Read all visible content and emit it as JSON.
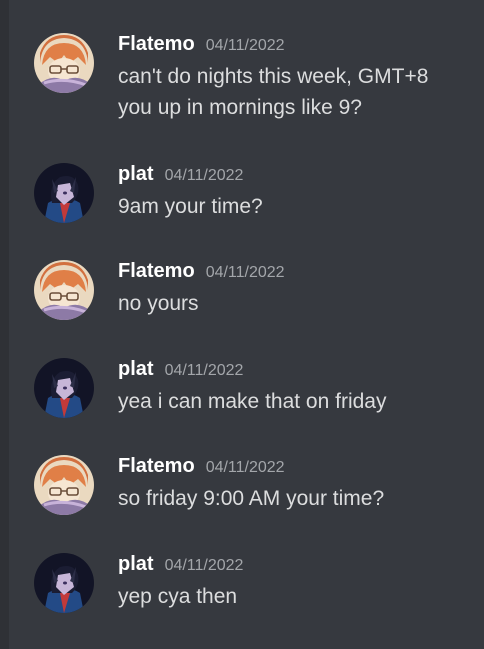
{
  "messages": [
    {
      "author": "Flatemo",
      "avatar": "flatemo-avatar",
      "timestamp": "04/11/2022",
      "lines": [
        "can't do nights this week, GMT+8",
        "you up in mornings like 9?"
      ]
    },
    {
      "author": "plat",
      "avatar": "plat-avatar",
      "timestamp": "04/11/2022",
      "lines": [
        "9am your time?"
      ]
    },
    {
      "author": "Flatemo",
      "avatar": "flatemo-avatar",
      "timestamp": "04/11/2022",
      "lines": [
        "no yours"
      ]
    },
    {
      "author": "plat",
      "avatar": "plat-avatar",
      "timestamp": "04/11/2022",
      "lines": [
        "yea i can make that on friday"
      ]
    },
    {
      "author": "Flatemo",
      "avatar": "flatemo-avatar",
      "timestamp": "04/11/2022",
      "lines": [
        "so friday 9:00 AM your time?"
      ]
    },
    {
      "author": "plat",
      "avatar": "plat-avatar",
      "timestamp": "04/11/2022",
      "lines": [
        "yep cya then"
      ]
    }
  ],
  "colors": {
    "background": "#36393f",
    "username": "#ffffff",
    "timestamp": "#a3a6aa",
    "text": "#dcddde"
  }
}
